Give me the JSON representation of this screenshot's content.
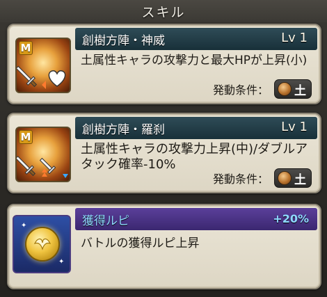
{
  "header": {
    "title": "スキル"
  },
  "skills": [
    {
      "name": "創樹方陣・神威",
      "level": "Lv 1",
      "description": "土属性キャラの攻撃力と最大HPが上昇(小)",
      "condition_label": "発動条件：",
      "condition_element": "土",
      "icon": "magna-sword-heart-icon",
      "badge": "M"
    },
    {
      "name": "創樹方陣・羅刹",
      "level": "Lv 1",
      "description": "土属性キャラの攻撃力上昇(中)/ダブルアタック確率-10%",
      "condition_label": "発動条件：",
      "condition_element": "土",
      "icon": "magna-sword-arrows-icon",
      "badge": "M"
    }
  ],
  "rupie": {
    "name": "獲得ルピ",
    "bonus": "+20%",
    "description": "バトルの獲得ルピ上昇",
    "icon": "rupie-coin-icon"
  }
}
